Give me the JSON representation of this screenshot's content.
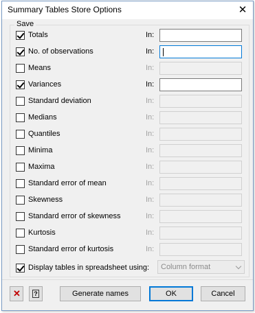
{
  "window": {
    "title": "Summary Tables Store Options",
    "close_glyph": "✕"
  },
  "group": {
    "label": "Save"
  },
  "options": [
    {
      "label": "Totals",
      "checked": true,
      "in_label": "In:",
      "enabled": true,
      "value": ""
    },
    {
      "label": "No. of observations",
      "checked": true,
      "in_label": "In:",
      "enabled": true,
      "value": "",
      "focused": true
    },
    {
      "label": "Means",
      "checked": false,
      "in_label": "In:",
      "enabled": false,
      "value": ""
    },
    {
      "label": "Variances",
      "checked": true,
      "in_label": "In:",
      "enabled": true,
      "value": ""
    },
    {
      "label": "Standard deviation",
      "checked": false,
      "in_label": "In:",
      "enabled": false,
      "value": ""
    },
    {
      "label": "Medians",
      "checked": false,
      "in_label": "In:",
      "enabled": false,
      "value": ""
    },
    {
      "label": "Quantiles",
      "checked": false,
      "in_label": "In:",
      "enabled": false,
      "value": ""
    },
    {
      "label": "Minima",
      "checked": false,
      "in_label": "In:",
      "enabled": false,
      "value": ""
    },
    {
      "label": "Maxima",
      "checked": false,
      "in_label": "In:",
      "enabled": false,
      "value": ""
    },
    {
      "label": "Standard error of mean",
      "checked": false,
      "in_label": "In:",
      "enabled": false,
      "value": ""
    },
    {
      "label": "Skewness",
      "checked": false,
      "in_label": "In:",
      "enabled": false,
      "value": ""
    },
    {
      "label": "Standard error of skewness",
      "checked": false,
      "in_label": "In:",
      "enabled": false,
      "value": ""
    },
    {
      "label": "Kurtosis",
      "checked": false,
      "in_label": "In:",
      "enabled": false,
      "value": ""
    },
    {
      "label": "Standard error of kurtosis",
      "checked": false,
      "in_label": "In:",
      "enabled": false,
      "value": ""
    }
  ],
  "spreadsheet": {
    "label": "Display tables in spreadsheet using:",
    "checked": true,
    "format": "Column format"
  },
  "buttons": {
    "generate": "Generate names",
    "ok": "OK",
    "cancel": "Cancel",
    "help_glyph": "?",
    "clear_glyph": "✕"
  },
  "colors": {
    "clear_icon": "#c00000",
    "focus_border": "#0078d7"
  }
}
